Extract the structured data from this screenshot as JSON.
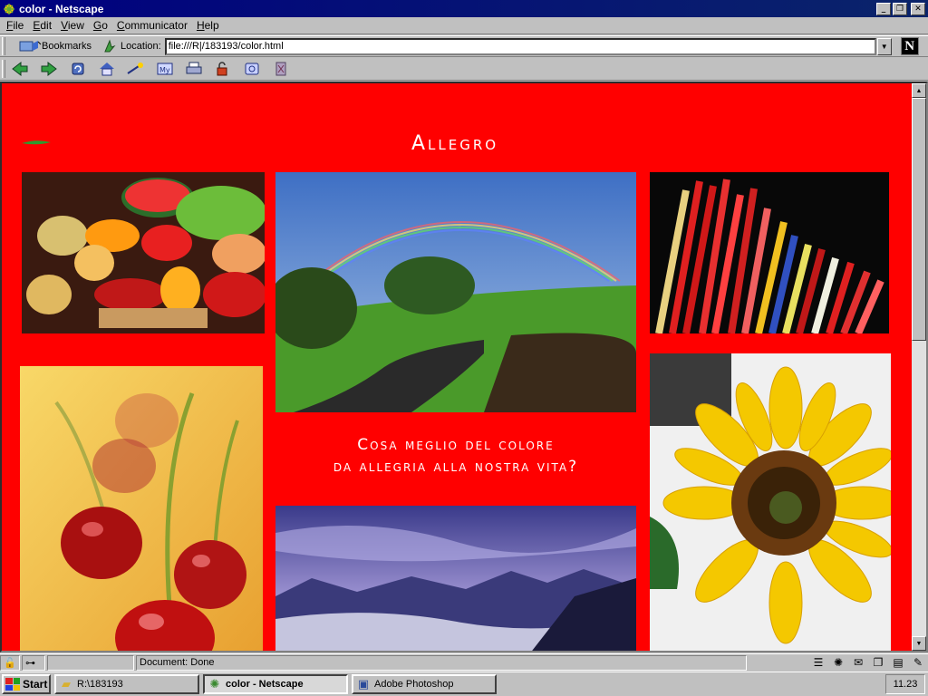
{
  "window": {
    "title": "color - Netscape",
    "minimize_glyph": "_",
    "maximize_glyph": "❐",
    "close_glyph": "✕"
  },
  "menu": [
    "File",
    "Edit",
    "View",
    "Go",
    "Communicator",
    "Help"
  ],
  "location_bar": {
    "bookmarks_label": "Bookmarks",
    "location_label": "Location:",
    "url": "file:///R|/183193/color.html"
  },
  "toolbar": {
    "icons": [
      "back-icon",
      "forward-icon",
      "reload-icon",
      "home-icon",
      "search-icon",
      "my-netscape-icon",
      "print-icon",
      "security-icon",
      "shop-icon",
      "stop-icon"
    ]
  },
  "page": {
    "heading": "Allegro",
    "tagline_line1": "Cosa meglio del colore",
    "tagline_line2": "da allegria alla nostra vita?",
    "background_color": "#ff0000",
    "photos": [
      "fruit-market-photo",
      "rainbow-road-photo",
      "colored-pencils-photo",
      "cherries-photo",
      "mountain-sky-photo",
      "sunflower-photo"
    ]
  },
  "status": {
    "text": "Document: Done"
  },
  "taskbar": {
    "start_label": "Start",
    "tasks": [
      {
        "label": "R:\\183193",
        "icon": "folder-icon",
        "active": false
      },
      {
        "label": "color - Netscape",
        "icon": "netscape-icon",
        "active": true
      },
      {
        "label": "Adobe Photoshop",
        "icon": "photoshop-icon",
        "active": false
      }
    ],
    "clock": "11.23"
  }
}
